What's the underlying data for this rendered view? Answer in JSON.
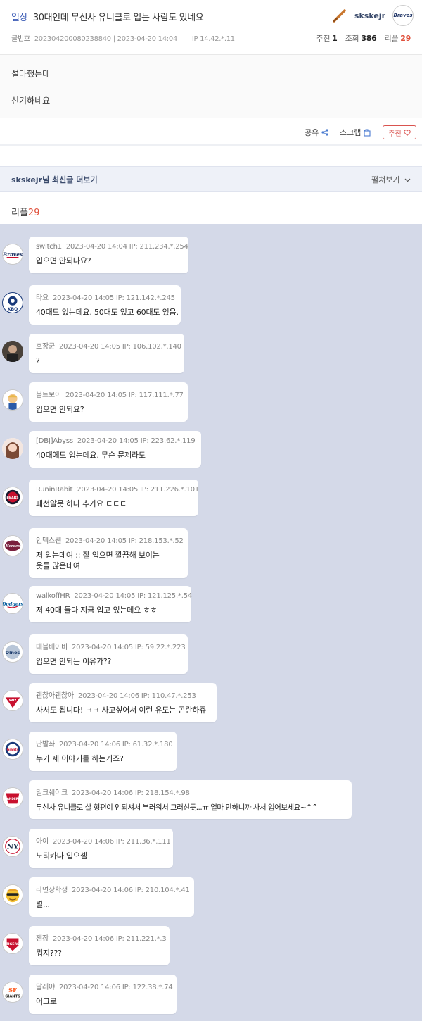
{
  "post": {
    "category": "일상",
    "title": "30대인데 무신사 유니클로 입는 사람도 있네요",
    "id_label": "글번호",
    "id": "202304200080238840",
    "date": "2023-04-20 14:04",
    "ip": "IP 14.42.*.11",
    "author": "skskejr",
    "author_avatar": "Braves",
    "recommend_label": "추천",
    "recommend": "1",
    "views_label": "조회",
    "views": "386",
    "replies_label": "리플",
    "replies": "29",
    "body": [
      "설마했는데",
      "신기하네요"
    ]
  },
  "actions": {
    "share": "공유",
    "scrap": "스크랩",
    "recommend": "추천"
  },
  "more_posts": {
    "title": "skskejr님 최신글 더보기",
    "toggle": "펼쳐보기"
  },
  "reply_header": {
    "label": "리플",
    "count": "29"
  },
  "comments": [
    {
      "nick": "switch1",
      "date": "2023-04-20 14:04",
      "ip": "IP: 211.234.*.254",
      "text": "입으면 안되나요?",
      "avatar": "Braves"
    },
    {
      "nick": "타요",
      "date": "2023-04-20 14:05",
      "ip": "IP: 121.142.*.245",
      "text": "40대도 있는데요. 50대도 있고 60대도 있음.",
      "avatar": "KBO"
    },
    {
      "nick": "호장군",
      "date": "2023-04-20 14:05",
      "ip": "IP: 106.102.*.140",
      "text": "?",
      "avatar": ""
    },
    {
      "nick": "볼트보이",
      "date": "2023-04-20 14:05",
      "ip": "IP: 117.111.*.77",
      "text": "입으면 안되요?",
      "avatar": ""
    },
    {
      "nick": "[DBJ]Abyss",
      "date": "2023-04-20 14:05",
      "ip": "IP: 223.62.*.119",
      "text": "40대에도 입는데요. 무슨 문제라도",
      "avatar": ""
    },
    {
      "nick": "RuninRabit",
      "date": "2023-04-20 14:05",
      "ip": "IP: 211.226.*.101",
      "text": "패션알못 하나 추가요 ㄷㄷㄷ",
      "avatar": "BEARS"
    },
    {
      "nick": "인덱스쌘",
      "date": "2023-04-20 14:05",
      "ip": "IP: 218.153.*.52",
      "text": "저 입는데여 :: 잘 입으면 깔끔해 보이는\n옷들 많은데여",
      "avatar": "Heroes"
    },
    {
      "nick": "walkoffHR",
      "date": "2023-04-20 14:05",
      "ip": "IP: 121.125.*.54",
      "text": "저 40대 둘다 지금 입고 있는데요 ㅎㅎ",
      "avatar": "Dodgers"
    },
    {
      "nick": "데블베이비",
      "date": "2023-04-20 14:05",
      "ip": "IP: 59.22.*.223",
      "text": "입으면 안되는 이유가??",
      "avatar": "Dinos"
    },
    {
      "nick": "괜찮아괜찮아",
      "date": "2023-04-20 14:06",
      "ip": "IP: 110.47.*.253",
      "text": "사셔도 됩니다! ㅋㅋ 사고싶어서 이런 유도는 곤란하쥬",
      "avatar": "Wiz"
    },
    {
      "nick": "단발좌",
      "date": "2023-04-20 14:06",
      "ip": "IP: 61.32.*.180",
      "text": "누가 제 이야기를 하는거죠?",
      "avatar": "Giants"
    },
    {
      "nick": "밀크쉐이크",
      "date": "2023-04-20 14:06",
      "ip": "IP: 218.154.*.98",
      "text": "무신사 유니클로 살 형편이 안되셔서 부러워서 그러신듯...ㅠ 얼마 안하니까 사서 입어보세요~^^",
      "avatar": "LANDERS"
    },
    {
      "nick": "아이",
      "date": "2023-04-20 14:06",
      "ip": "IP: 211.36.*.111",
      "text": "노티카나 입으셈",
      "avatar": "NY"
    },
    {
      "nick": "라면장학생",
      "date": "2023-04-20 14:06",
      "ip": "IP: 210.104.*.41",
      "text": "별...",
      "avatar": ""
    },
    {
      "nick": "젠장",
      "date": "2023-04-20 14:06",
      "ip": "IP: 211.221.*.3",
      "text": "뭐지???",
      "avatar": "TIGERS"
    },
    {
      "nick": "달래야",
      "date": "2023-04-20 14:06",
      "ip": "IP: 122.38.*.74",
      "text": "어그로",
      "avatar": "GIANTS"
    }
  ]
}
